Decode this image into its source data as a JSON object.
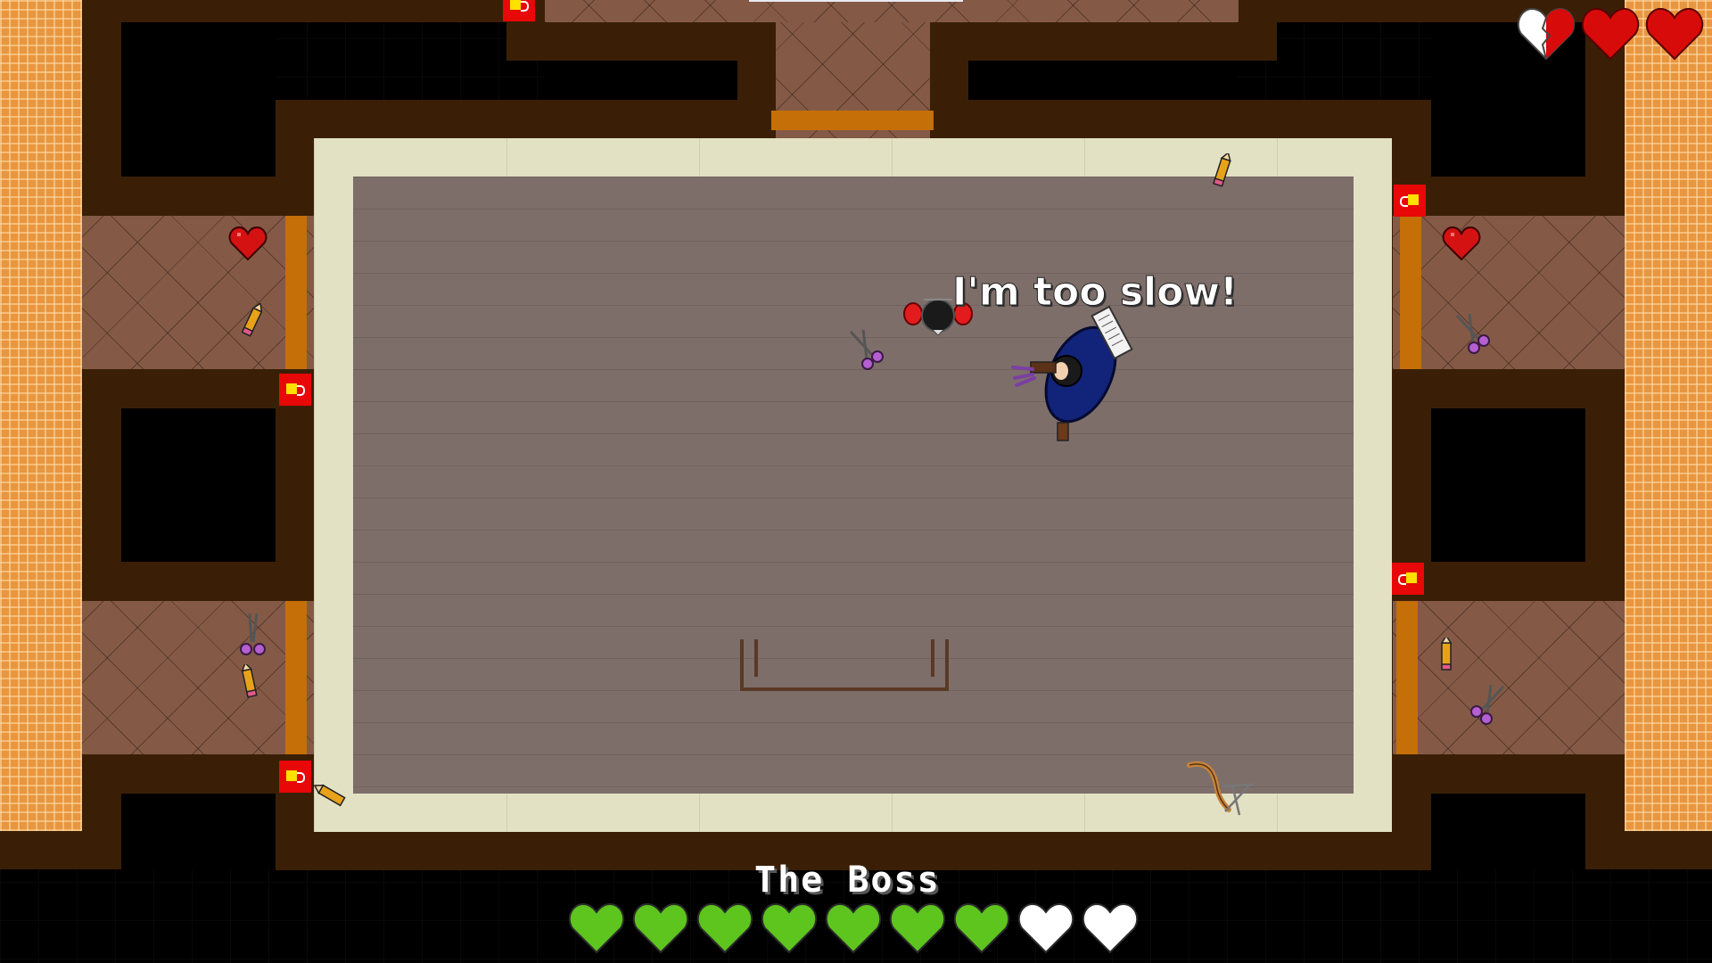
{
  "hud": {
    "player_hearts": [
      "half",
      "full",
      "full"
    ],
    "heart_color": "#e40d0d",
    "empty_heart_color": "#ffffff"
  },
  "boss": {
    "name": "The Boss",
    "health_hearts": [
      "full",
      "full",
      "full",
      "full",
      "full",
      "full",
      "full",
      "empty",
      "empty"
    ],
    "health_color": "#5ec41e",
    "empty_color": "#ffffff"
  },
  "dialogue": {
    "speech": "I'm too slow!"
  },
  "colors": {
    "wall": "#3a1f06",
    "carpet": "#845a47",
    "room_floor": "#7e6e6a",
    "room_border": "#e3e1c4",
    "door": "#c46f08",
    "switch": "#e80808",
    "outer_tile": "#e8963f"
  },
  "items": [
    "pencil-icon",
    "scissors-icon",
    "heart-pickup-icon",
    "boomerang-icon",
    "chair-icon"
  ]
}
